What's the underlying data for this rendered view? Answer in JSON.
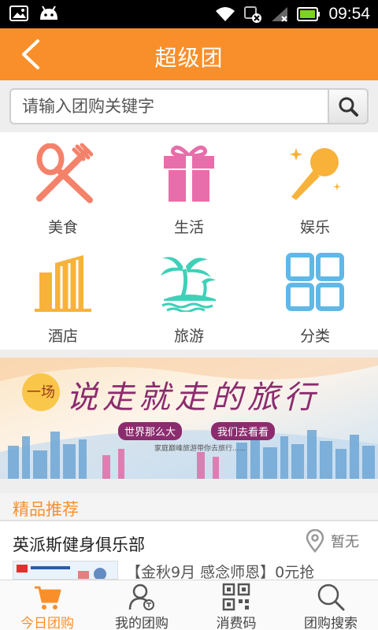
{
  "status_bar": {
    "time": "09:54",
    "left_icons": [
      "image-icon",
      "android-icon"
    ],
    "right_icons": [
      "wifi-icon",
      "sync-off-icon",
      "signal-icon",
      "battery-icon"
    ]
  },
  "header": {
    "title": "超级团",
    "back_icon": "chevron-left-icon",
    "background": "#f98f2a"
  },
  "search": {
    "placeholder": "请输入团购关键字",
    "icon": "search-icon"
  },
  "categories": [
    {
      "label": "美食",
      "icon": "utensils-icon",
      "color": "#f4826a"
    },
    {
      "label": "生活",
      "icon": "gift-icon",
      "color": "#e76eaa"
    },
    {
      "label": "娱乐",
      "icon": "microphone-icon",
      "color": "#f8b23a"
    },
    {
      "label": "酒店",
      "icon": "building-icon",
      "color": "#f8b23a"
    },
    {
      "label": "旅游",
      "icon": "palm-island-icon",
      "color": "#3fd0b8"
    },
    {
      "label": "分类",
      "icon": "grid-icon",
      "color": "#5fb8e8"
    }
  ],
  "banner": {
    "headline": "说走就走的旅行",
    "badge": "一场",
    "tagline_left": "世界那么大",
    "tagline_right": "我们去看看",
    "subline": "家庭巅峰旅游带你去旅行......"
  },
  "recommend": {
    "section_title": "精品推荐",
    "deal": {
      "name": "英派斯健身俱乐部",
      "location": "暂无",
      "description": "【金秋9月 感念师恩】0元抢"
    }
  },
  "tabs": [
    {
      "label": "今日团购",
      "icon": "cart-icon",
      "active": true
    },
    {
      "label": "我的团购",
      "icon": "user-icon",
      "active": false
    },
    {
      "label": "消费码",
      "icon": "qr-code-icon",
      "active": false
    },
    {
      "label": "团购搜索",
      "icon": "search-icon",
      "active": false
    }
  ],
  "colors": {
    "accent": "#f98f2a",
    "text": "#444444"
  }
}
